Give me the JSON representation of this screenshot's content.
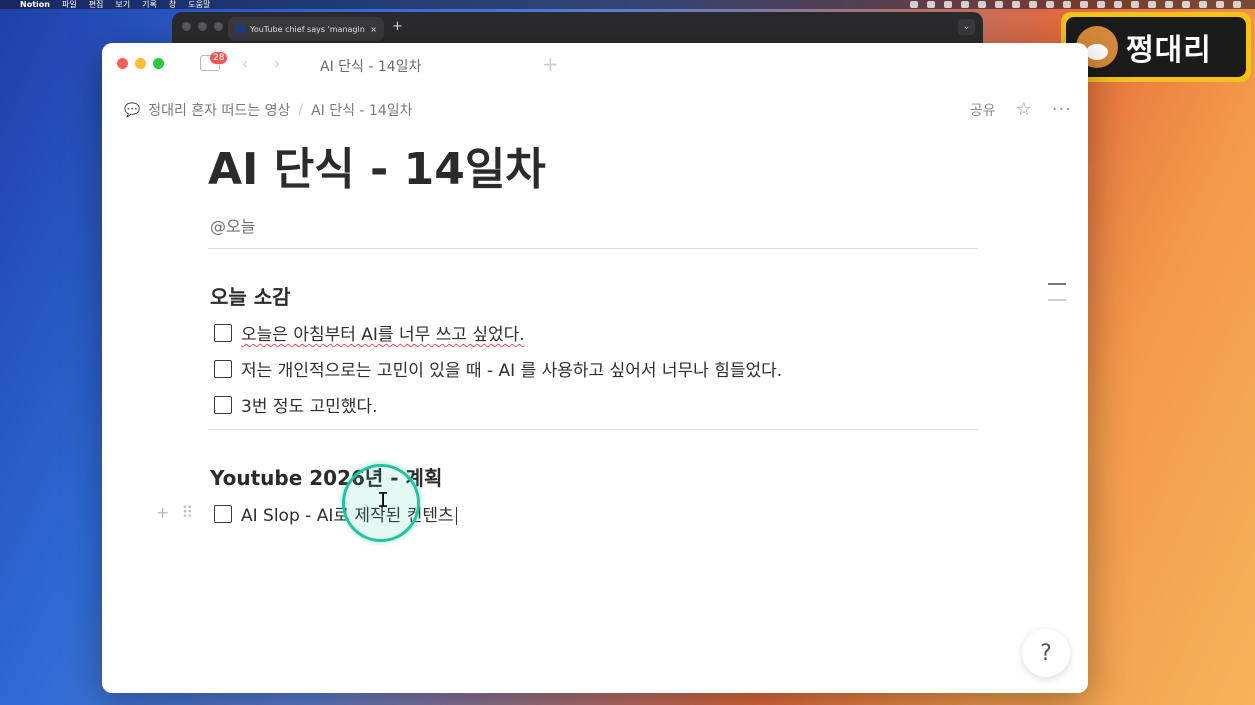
{
  "menubar": {
    "app_name": "Notion",
    "items": [
      "파일",
      "편집",
      "보기",
      "기록",
      "창",
      "도움말"
    ]
  },
  "browser": {
    "tab_title": "YouTube chief says 'managing...",
    "tab_close": "×",
    "new_tab": "+",
    "dropdown": "⌄"
  },
  "logo": {
    "name": "쩡대리"
  },
  "notion": {
    "badge_count": "28",
    "window_title": "AI 단식 - 14일차",
    "add_tab": "+",
    "breadcrumb": {
      "parent": "정대리 혼자 떠드는 영상",
      "separator": "/",
      "current": "AI 단식 - 14일차"
    },
    "share_label": "공유",
    "page_title": "AI 단식 - 14일차",
    "date_property": "@오늘",
    "sections": [
      {
        "heading": "오늘 소감",
        "todos": [
          "오늘은 아침부터 AI를 너무 쓰고 싶었다.",
          "저는 개인적으로는 고민이 있을 때  - AI 를 사용하고 싶어서 너무나 힘들었다.",
          "3번 정도 고민했다."
        ]
      },
      {
        "heading": "Youtube 2026년 - 계획",
        "todos": [
          "AI Slop - AI로 제작된 컨텐츠"
        ]
      }
    ],
    "help_icon": "?"
  },
  "colors": {
    "accent_cursor": "#21c3a2",
    "spell_underline": "#e35d5d",
    "notion_badge": "#eb5757"
  }
}
